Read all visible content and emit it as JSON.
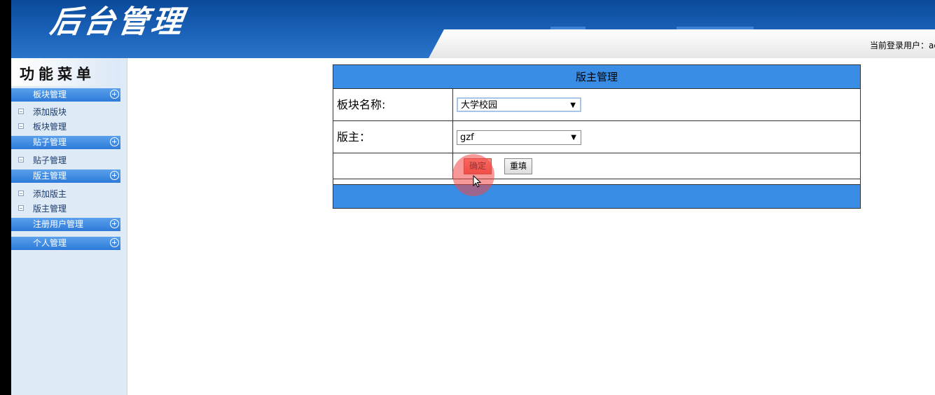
{
  "header": {
    "logo_text": "后台管理",
    "current_user": "当前登录用户：adr"
  },
  "sidebar": {
    "title": "功能菜单",
    "sections": [
      {
        "label": "板块管理",
        "items": [
          "添加版块",
          "板块管理"
        ]
      },
      {
        "label": "贴子管理",
        "items": [
          "贴子管理"
        ]
      },
      {
        "label": "版主管理",
        "items": [
          "添加版主",
          "版主管理"
        ]
      },
      {
        "label": "注册用户管理",
        "items": []
      },
      {
        "label": "个人管理",
        "items": []
      }
    ]
  },
  "form": {
    "title": "版主管理",
    "fields": {
      "board_label": "板块名称:",
      "board_value": "大学校园",
      "moderator_label": "版主：",
      "moderator_value": "gzf"
    },
    "buttons": {
      "submit": "确定",
      "reset": "重填"
    }
  },
  "colors": {
    "header_blue": "#1a62b8",
    "table_blue": "#3a8de5",
    "sidebar_bg": "#dfeaf7",
    "click_highlight": "#f04646"
  }
}
